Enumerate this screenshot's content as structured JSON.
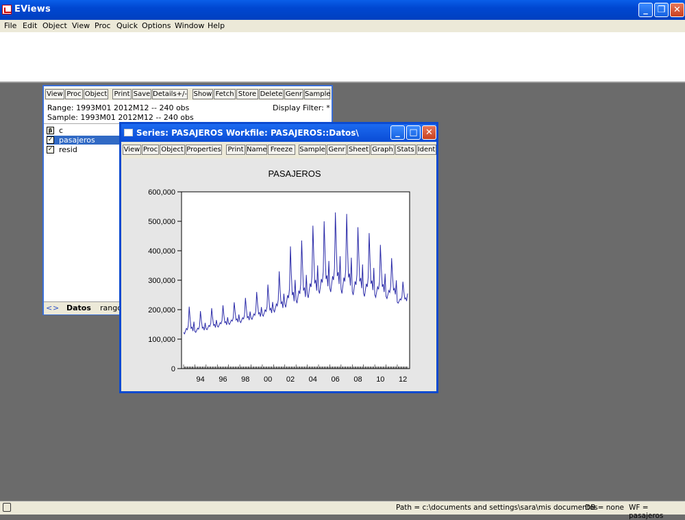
{
  "app": {
    "title": "EViews"
  },
  "menu": [
    "File",
    "Edit",
    "Object",
    "View",
    "Proc",
    "Quick",
    "Options",
    "Window",
    "Help"
  ],
  "workfile": {
    "toolbar": [
      "View",
      "Proc",
      "Object",
      "Print",
      "Save",
      "Details+/-",
      "Show",
      "Fetch",
      "Store",
      "Delete",
      "Genr",
      "Sample"
    ],
    "range": "Range:  1993M01 2012M12  --  240 obs",
    "sample": "Sample: 1993M01 2012M12  --  240 obs",
    "display_filter": "Display Filter: *",
    "objects": [
      "c",
      "pasajeros",
      "resid"
    ],
    "selected": "pasajeros",
    "tabs": [
      "Datos",
      "rango"
    ]
  },
  "series_window": {
    "title": "Series: PASAJEROS   Workfile: PASAJEROS::Datos\\",
    "toolbar": [
      "View",
      "Proc",
      "Object",
      "Properties",
      "Print",
      "Name",
      "Freeze",
      "Sample",
      "Genr",
      "Sheet",
      "Graph",
      "Stats",
      "Ident"
    ]
  },
  "chart_data": {
    "type": "line",
    "title": "PASAJEROS",
    "xlabel": "",
    "ylabel": "",
    "ylim": [
      0,
      600000
    ],
    "yticks": [
      "0",
      "100,000",
      "200,000",
      "300,000",
      "400,000",
      "500,000",
      "600,000"
    ],
    "xticks": [
      "94",
      "96",
      "98",
      "00",
      "02",
      "04",
      "06",
      "08",
      "10",
      "12"
    ],
    "x_range": [
      "1993M01",
      "2012M12"
    ],
    "series": [
      {
        "name": "PASAJEROS",
        "color": "#2a2aa8",
        "annual_base": [
          118000,
          123000,
          132000,
          141000,
          150000,
          156000,
          167000,
          178000,
          192000,
          208000,
          222000,
          240000,
          255000,
          260000,
          255000,
          250000,
          245000,
          242000,
          238000,
          222000
        ],
        "annual_peak": [
          210000,
          195000,
          205000,
          215000,
          225000,
          240000,
          260000,
          285000,
          330000,
          415000,
          435000,
          485000,
          500000,
          530000,
          525000,
          480000,
          460000,
          420000,
          375000,
          295000
        ]
      }
    ]
  },
  "status": {
    "path": "Path = c:\\documents and settings\\sara\\mis documentos",
    "db": "DB = none",
    "wf": "WF = pasajeros"
  }
}
